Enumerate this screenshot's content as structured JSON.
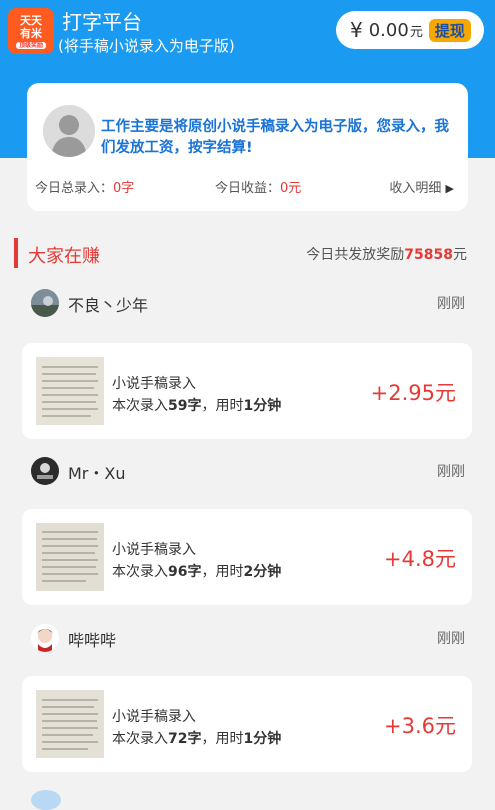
{
  "header": {
    "logo_line1": "天天",
    "logo_line2": "有米",
    "logo_tag": "顶级奖励",
    "title": "打字平台",
    "subtitle": "(将手稿小说录入为电子版)",
    "currency_symbol": "¥",
    "balance": "0.00",
    "balance_unit": "元",
    "withdraw_label": "提现"
  },
  "intro_card": {
    "text": "工作主要是将原创小说手稿录入为电子版，您录入，我们发放工资，按字结算!",
    "total_label": "今日总录入：",
    "total_value": "0字",
    "income_label": "今日收益：",
    "income_value": "0元",
    "detail_label": "收入明细",
    "detail_arrow": "▶"
  },
  "section": {
    "title": "大家在赚",
    "reward_prefix": "今日共发放奖励",
    "reward_value": "75858",
    "reward_unit": "元"
  },
  "feed": [
    {
      "user": "不良丶少年",
      "time": "刚刚",
      "task": "小说手稿录入",
      "prefix": "本次录入",
      "chars": "59字",
      "mid": "，用时",
      "duration": "1分钟",
      "amount": "+2.95元"
    },
    {
      "user": "Mr・Xu",
      "time": "刚刚",
      "task": "小说手稿录入",
      "prefix": "本次录入",
      "chars": "96字",
      "mid": "，用时",
      "duration": "2分钟",
      "amount": "+4.8元"
    },
    {
      "user": "哔哔哔",
      "time": "刚刚",
      "task": "小说手稿录入",
      "prefix": "本次录入",
      "chars": "72字",
      "mid": "，用时",
      "duration": "1分钟",
      "amount": "+3.6元"
    }
  ],
  "colors": {
    "header_blue": "#1a9af0",
    "accent_red": "#e53935",
    "intro_blue": "#1a73d6",
    "withdraw_yellow": "#f6a800"
  }
}
